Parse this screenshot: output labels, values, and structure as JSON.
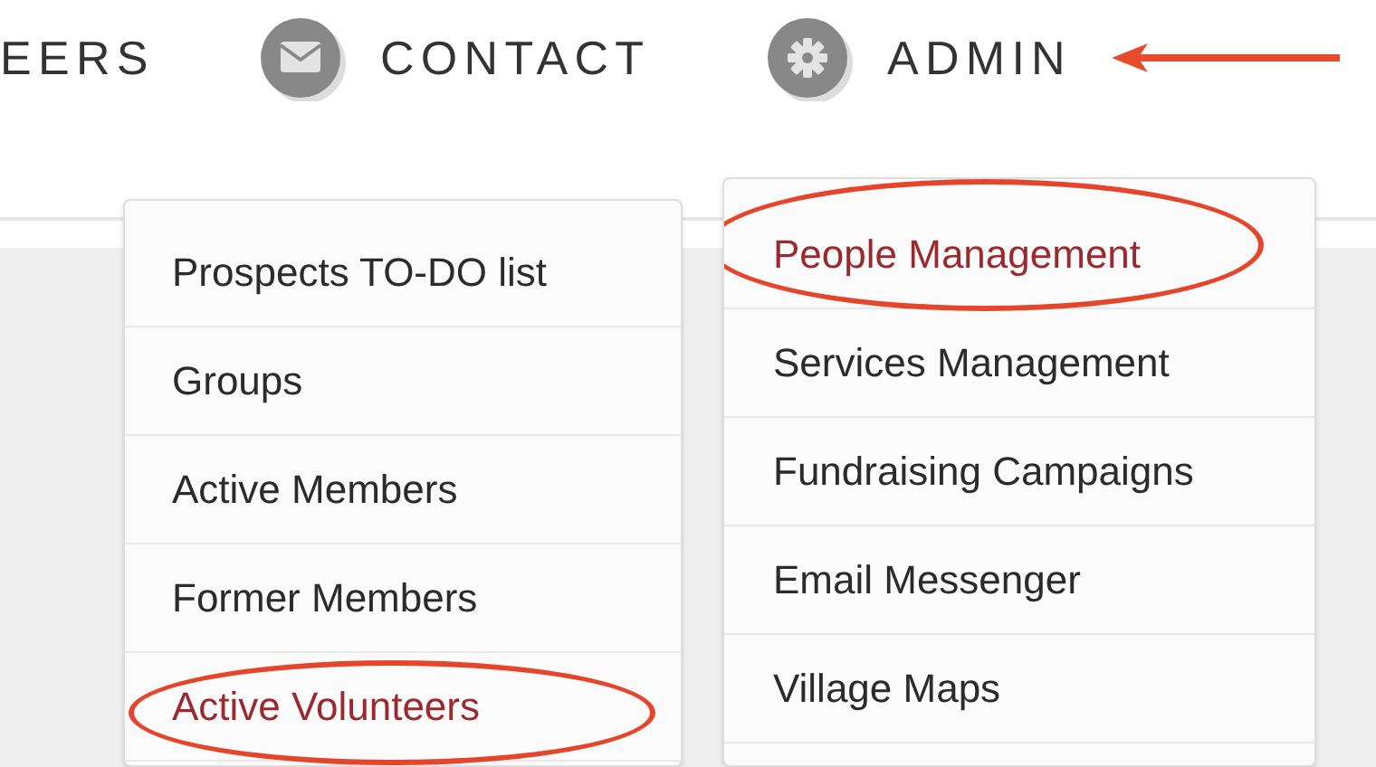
{
  "nav": [
    {
      "label": "EERS",
      "kind": "plain",
      "pointed": false
    },
    {
      "label": "CONTACT",
      "kind": "mail",
      "pointed": false
    },
    {
      "label": "ADMIN",
      "kind": "settings",
      "pointed": true
    }
  ],
  "menus": [
    {
      "items": [
        {
          "label": "Prospects TO-DO list",
          "selected": false,
          "circled": false
        },
        {
          "label": "Groups",
          "selected": false,
          "circled": false
        },
        {
          "label": "Active Members",
          "selected": false,
          "circled": false
        },
        {
          "label": "Former Members",
          "selected": false,
          "circled": false
        },
        {
          "label": "Active Volunteers",
          "selected": true,
          "circled": true
        }
      ]
    },
    {
      "items": [
        {
          "label": "People Management",
          "selected": true,
          "circled": true
        },
        {
          "label": "Services Management",
          "selected": false,
          "circled": false
        },
        {
          "label": "Fundraising Campaigns",
          "selected": false,
          "circled": false
        },
        {
          "label": "Email Messenger",
          "selected": false,
          "circled": false
        },
        {
          "label": "Village Maps",
          "selected": false,
          "circled": false
        }
      ]
    }
  ]
}
